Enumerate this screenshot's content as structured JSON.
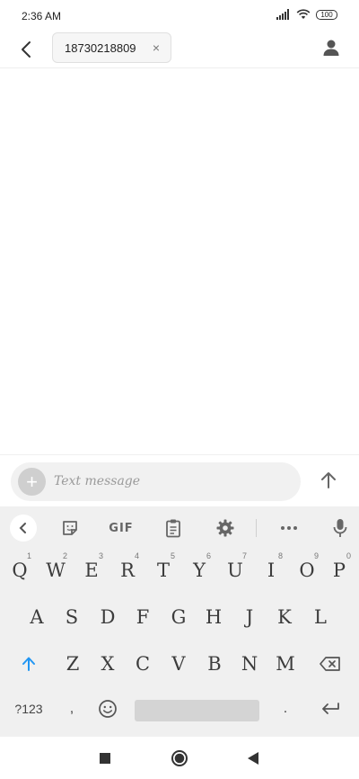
{
  "status_bar": {
    "time": "2:36 AM",
    "battery": "100"
  },
  "header": {
    "recipient_chip": {
      "label": "18730218809",
      "close": "×"
    }
  },
  "compose": {
    "placeholder": "Text message"
  },
  "keyboard": {
    "toolbar": {
      "gif_label": "GIF",
      "more_label": "•••"
    },
    "row1": [
      {
        "label": "Q",
        "hint": "1"
      },
      {
        "label": "W",
        "hint": "2"
      },
      {
        "label": "E",
        "hint": "3"
      },
      {
        "label": "R",
        "hint": "4"
      },
      {
        "label": "T",
        "hint": "5"
      },
      {
        "label": "Y",
        "hint": "6"
      },
      {
        "label": "U",
        "hint": "7"
      },
      {
        "label": "I",
        "hint": "8"
      },
      {
        "label": "O",
        "hint": "9"
      },
      {
        "label": "P",
        "hint": "0"
      }
    ],
    "row2": [
      "A",
      "S",
      "D",
      "F",
      "G",
      "H",
      "J",
      "K",
      "L"
    ],
    "row3": [
      "Z",
      "X",
      "C",
      "V",
      "B",
      "N",
      "M"
    ],
    "row4": {
      "symbols_label": "?123",
      "comma_label": ",",
      "period_label": "."
    }
  },
  "colors": {
    "accent": "#2196f3",
    "keyboard_bg": "#f0f0f0"
  }
}
